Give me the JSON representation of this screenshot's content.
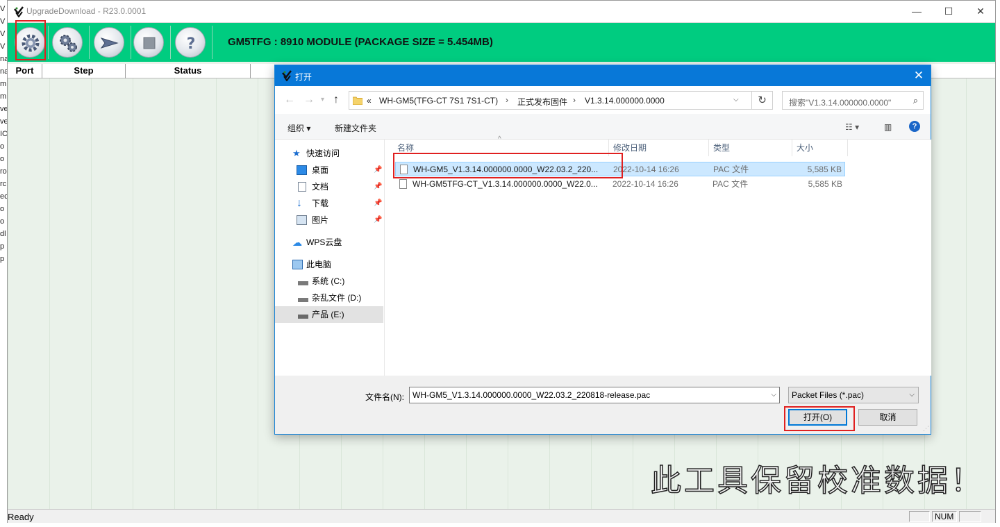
{
  "background_strip": [
    "V",
    "V",
    "V",
    "V",
    "na",
    "na",
    "m",
    "m",
    "ve",
    "ve",
    "IC",
    "o",
    "o",
    "ro",
    "rc",
    "ec",
    "o",
    "o",
    "dl",
    "p",
    "p"
  ],
  "app": {
    "title": "UpgradeDownload - R23.0.0001",
    "package_title": "GM5TFG : 8910 MODULE (PACKAGE SIZE = 5.454MB)",
    "toolbar_icons": [
      "settings-gear-icon",
      "settings-gears-icon",
      "start-arrow-icon",
      "stop-square-icon",
      "help-icon"
    ],
    "columns": [
      "Port",
      "Step",
      "Status"
    ],
    "status_ready": "Ready",
    "status_num": "NUM",
    "highlight_color": "#e02020",
    "toolbar_color": "#00cc80"
  },
  "dialog": {
    "title": "打开",
    "close_glyph": "✕",
    "breadcrumb_prefix": "«",
    "breadcrumbs": [
      "WH-GM5(TFG-CT 7S1 7S1-CT)",
      "正式发布固件",
      "V1.3.14.000000.0000"
    ],
    "search_placeholder": "搜索\"V1.3.14.000000.0000\"",
    "commands": {
      "organize": "组织 ▾",
      "new_folder": "新建文件夹"
    },
    "nav": [
      {
        "label": "快速访问",
        "icon": "quick-access-star-icon"
      },
      {
        "label": "桌面",
        "icon": "desktop-icon"
      },
      {
        "label": "文档",
        "icon": "documents-icon"
      },
      {
        "label": "下载",
        "icon": "downloads-icon"
      },
      {
        "label": "图片",
        "icon": "pictures-icon"
      },
      {
        "label": "WPS云盘",
        "icon": "cloud-icon"
      },
      {
        "label": "此电脑",
        "icon": "this-pc-icon"
      },
      {
        "label": "系统 (C:)",
        "icon": "drive-c-icon"
      },
      {
        "label": "杂乱文件 (D:)",
        "icon": "drive-d-icon"
      },
      {
        "label": "产品 (E:)",
        "icon": "drive-e-icon"
      }
    ],
    "columns": {
      "name": "名称",
      "date": "修改日期",
      "type": "类型",
      "size": "大小"
    },
    "files": [
      {
        "name": "WH-GM5_V1.3.14.000000.0000_W22.03.2_220...",
        "date": "2022-10-14 16:26",
        "type": "PAC 文件",
        "size": "5,585 KB"
      },
      {
        "name": "WH-GM5TFG-CT_V1.3.14.000000.0000_W22.0...",
        "date": "2022-10-14 16:26",
        "type": "PAC 文件",
        "size": "5,585 KB"
      }
    ],
    "filename_label": "文件名(N):",
    "filename_value": "WH-GM5_V1.3.14.000000.0000_W22.03.2_220818-release.pac",
    "filter": "Packet Files (*.pac)",
    "open_button": "打开(O)",
    "cancel_button": "取消"
  },
  "watermark": "此工具保留校准数据！"
}
